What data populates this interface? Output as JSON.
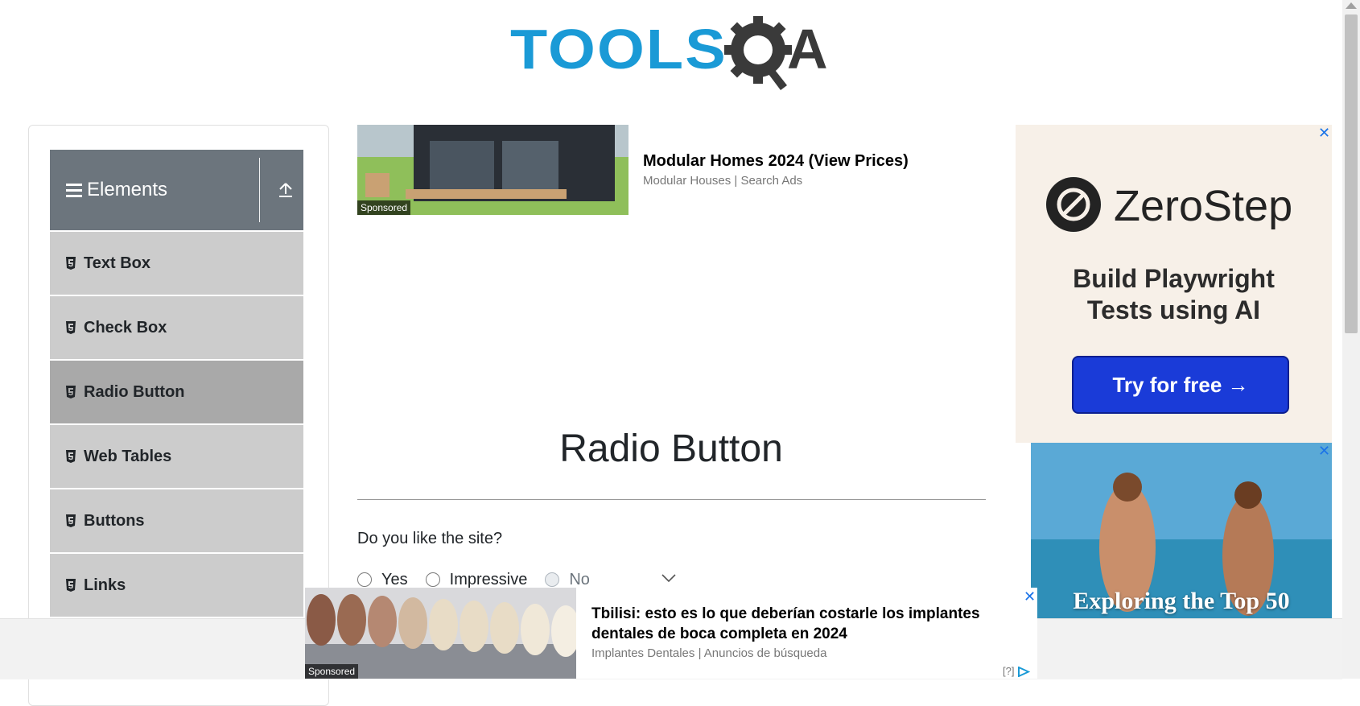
{
  "header": {
    "logo_text_primary": "TOOLS",
    "logo_text_secondary": "A",
    "logo_colors": {
      "tools": "#1a9ad6",
      "qa": "#3a3a3a"
    }
  },
  "sidebar": {
    "group_title": "Elements",
    "items": [
      {
        "label": "Text Box",
        "active": false
      },
      {
        "label": "Check Box",
        "active": false
      },
      {
        "label": "Radio Button",
        "active": true
      },
      {
        "label": "Web Tables",
        "active": false
      },
      {
        "label": "Buttons",
        "active": false
      },
      {
        "label": "Links",
        "active": false
      }
    ],
    "colors": {
      "header": "#6c757d",
      "item": "#cccccc",
      "active_item": "#a9a9a9"
    }
  },
  "ad_top": {
    "sponsored": "Sponsored",
    "title": "Modular Homes 2024 (View Prices)",
    "source": "Modular Houses | Search Ads"
  },
  "main": {
    "title": "Radio Button",
    "question": "Do you like the site?",
    "options": [
      {
        "label": "Yes",
        "disabled": false,
        "checked": false
      },
      {
        "label": "Impressive",
        "disabled": false,
        "checked": false
      },
      {
        "label": "No",
        "disabled": true,
        "checked": false
      }
    ]
  },
  "ad_right": {
    "close": "✕",
    "brand": "ZeroStep",
    "tagline_line1": "Build Playwright",
    "tagline_line2": "Tests using AI",
    "cta": "Try for free →",
    "cta_color": "#1a3bd8"
  },
  "ad_right2": {
    "close": "✕",
    "caption": "Exploring the Top 50"
  },
  "ad_bottom": {
    "close": "✕",
    "sponsored": "Sponsored",
    "title": "Tbilisi: esto es lo que deberían costarle los implantes dentales de boca completa en 2024",
    "source": "Implantes Dentales | Anuncios de búsqueda",
    "adinfo": "[?]"
  },
  "icons": {
    "hamburger": "hamburger-icon",
    "collapse": "upload-arrow-icon",
    "menu_item": "html5-icon",
    "chevron": "chevron-down-icon"
  }
}
